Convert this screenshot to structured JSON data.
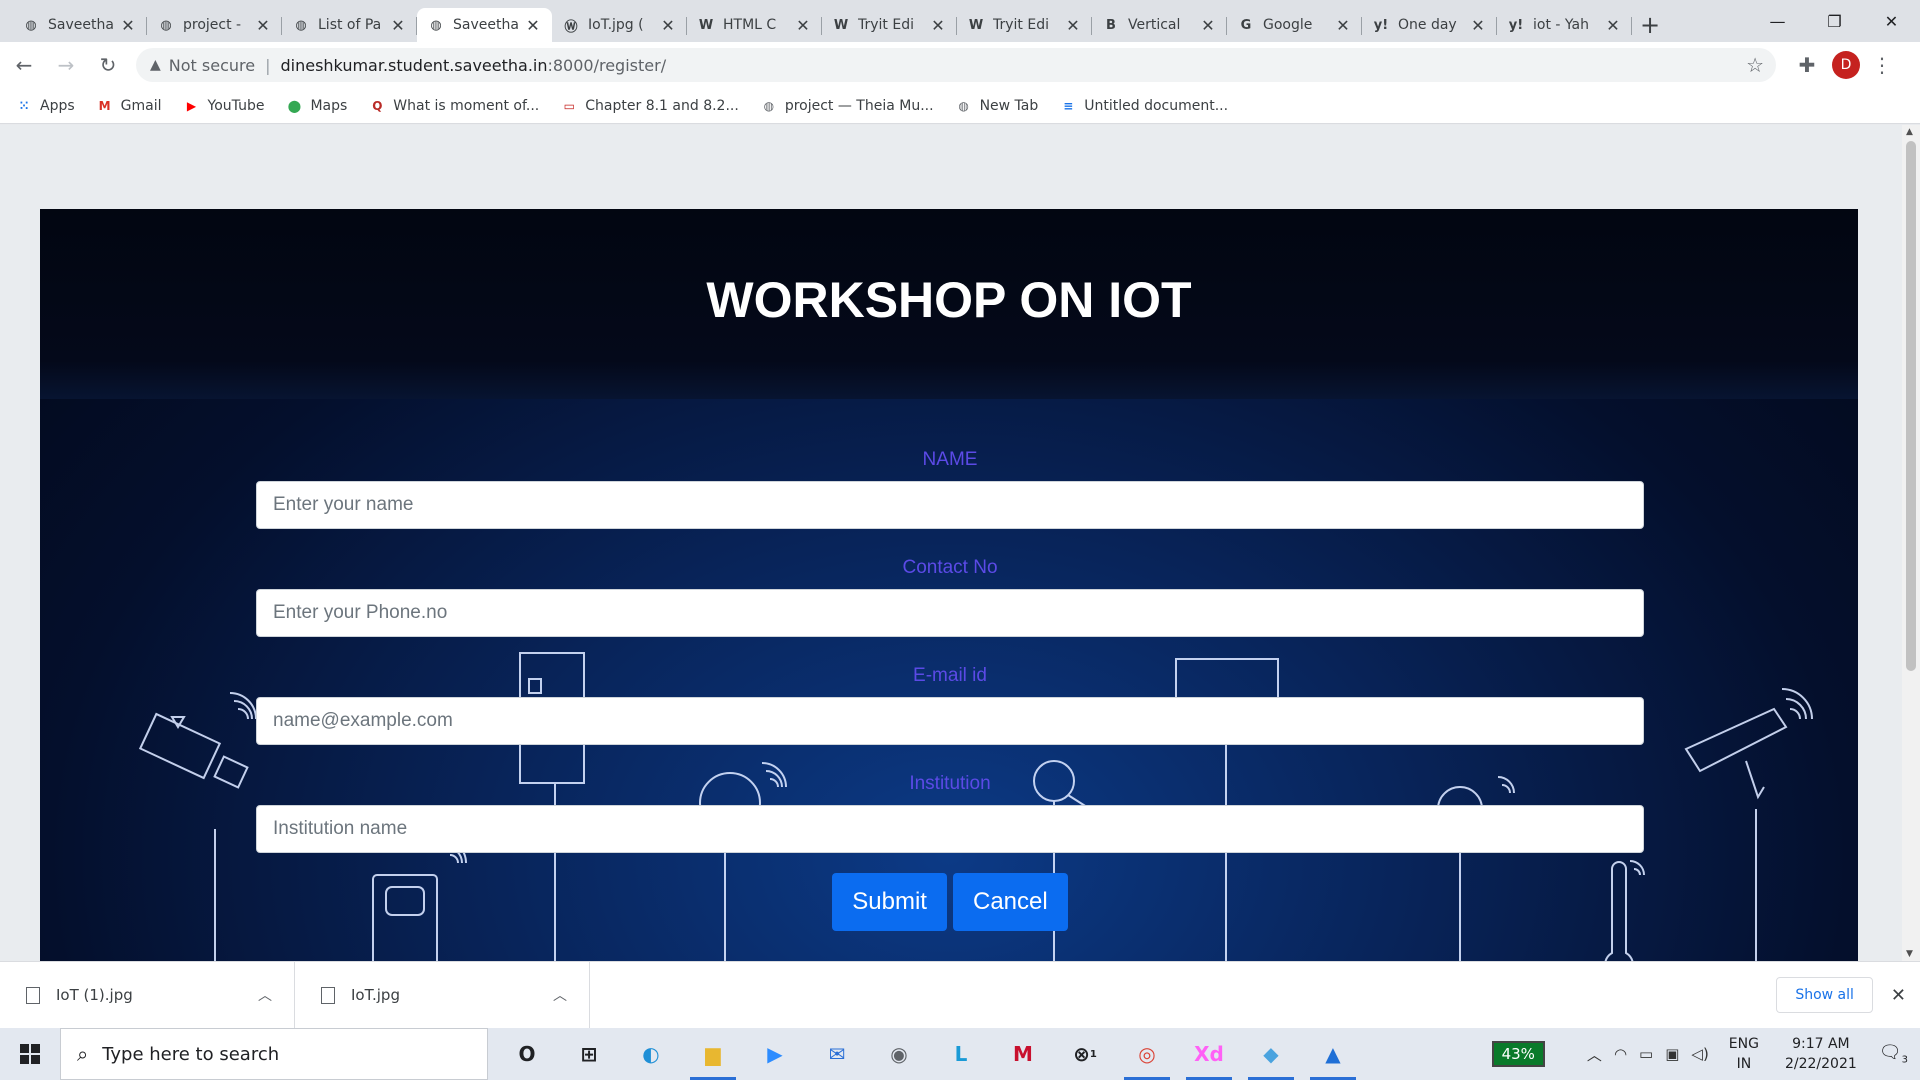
{
  "browser": {
    "tabs": [
      {
        "title": "Saveetha",
        "favicon": "globe-icon",
        "fav_glyph": "◍",
        "active": false
      },
      {
        "title": "project -",
        "favicon": "globe-icon",
        "fav_glyph": "◍",
        "active": false
      },
      {
        "title": "List of Pa",
        "favicon": "globe-icon",
        "fav_glyph": "◍",
        "active": false
      },
      {
        "title": "Saveetha",
        "favicon": "globe-icon",
        "fav_glyph": "◍",
        "active": true
      },
      {
        "title": "IoT.jpg (",
        "favicon": "wordpress-icon",
        "fav_glyph": "Ⓦ",
        "active": false
      },
      {
        "title": "HTML C",
        "favicon": "w3schools-icon",
        "fav_glyph": "W",
        "active": false
      },
      {
        "title": "Tryit Edi",
        "favicon": "w3schools-icon",
        "fav_glyph": "W",
        "active": false
      },
      {
        "title": "Tryit Edi",
        "favicon": "w3schools-icon",
        "fav_glyph": "W",
        "active": false
      },
      {
        "title": "Vertical",
        "favicon": "bootstrap-icon",
        "fav_glyph": "B",
        "active": false
      },
      {
        "title": "Google",
        "favicon": "google-icon",
        "fav_glyph": "G",
        "active": false
      },
      {
        "title": "One day",
        "favicon": "yahoo-icon",
        "fav_glyph": "y!",
        "active": false
      },
      {
        "title": "iot - Yah",
        "favicon": "yahoo-icon",
        "fav_glyph": "y!",
        "active": false
      }
    ],
    "security_label": "Not secure",
    "url_host": "dineshkumar.student.saveetha.in",
    "url_path": ":8000/register/",
    "profile_initial": "D",
    "bookmarks": [
      {
        "label": "Apps",
        "icon": "apps-grid-icon",
        "glyph": "⁙",
        "color": "#1a73e8"
      },
      {
        "label": "Gmail",
        "icon": "gmail-icon",
        "glyph": "M",
        "color": "#d93025"
      },
      {
        "label": "YouTube",
        "icon": "youtube-icon",
        "glyph": "▶",
        "color": "#ff0000"
      },
      {
        "label": "Maps",
        "icon": "maps-pin-icon",
        "glyph": "⬤",
        "color": "#34a853"
      },
      {
        "label": "What is moment of...",
        "icon": "quora-icon",
        "glyph": "Q",
        "color": "#b92b27"
      },
      {
        "label": "Chapter 8.1 and 8.2...",
        "icon": "slides-icon",
        "glyph": "▭",
        "color": "#c5221f"
      },
      {
        "label": "project — Theia Mu...",
        "icon": "globe-icon",
        "glyph": "◍",
        "color": "#5f6368"
      },
      {
        "label": "New Tab",
        "icon": "globe-icon",
        "glyph": "◍",
        "color": "#5f6368"
      },
      {
        "label": "Untitled document...",
        "icon": "docs-icon",
        "glyph": "≡",
        "color": "#1a73e8"
      }
    ]
  },
  "page": {
    "title": "WORKSHOP ON IOT",
    "fields": [
      {
        "label": "NAME",
        "placeholder": "Enter your name"
      },
      {
        "label": "Contact No",
        "placeholder": "Enter your Phone.no"
      },
      {
        "label": "E-mail id",
        "placeholder": "name@example.com"
      },
      {
        "label": "Institution",
        "placeholder": "Institution name"
      }
    ],
    "submit_label": "Submit",
    "cancel_label": "Cancel"
  },
  "downloads": {
    "items": [
      {
        "name": "IoT (1).jpg"
      },
      {
        "name": "IoT.jpg"
      }
    ],
    "show_all_label": "Show all"
  },
  "taskbar": {
    "search_placeholder": "Type here to search",
    "battery": "43%",
    "lang_line1": "ENG",
    "lang_line2": "IN",
    "time": "9:17 AM",
    "date": "2/22/2021",
    "notification_count": "3",
    "xbox_badge": "1",
    "apps": [
      {
        "name": "task-view-icon",
        "glyph": "O",
        "color": "#202124",
        "open": false
      },
      {
        "name": "widgets-icon",
        "glyph": "⊞",
        "color": "#202124",
        "open": false
      },
      {
        "name": "edge-icon",
        "glyph": "◐",
        "color": "#1f8fd6",
        "open": false
      },
      {
        "name": "file-explorer-icon",
        "glyph": "▆",
        "color": "#e8b730",
        "open": true
      },
      {
        "name": "zoom-icon",
        "glyph": "▶",
        "color": "#2d8cff",
        "open": false
      },
      {
        "name": "mail-icon",
        "glyph": "✉",
        "color": "#2b6fd6",
        "open": false
      },
      {
        "name": "camera-icon",
        "glyph": "◉",
        "color": "#5f6368",
        "open": false
      },
      {
        "name": "lens-l-icon",
        "glyph": "L",
        "color": "#1a9ad6",
        "open": false
      },
      {
        "name": "mcafee-icon",
        "glyph": "M",
        "color": "#c8102e",
        "open": false
      },
      {
        "name": "xbox-icon",
        "glyph": "⊗",
        "color": "#202124",
        "open": false
      },
      {
        "name": "chrome-icon",
        "glyph": "◎",
        "color": "#db4437",
        "open": true
      },
      {
        "name": "adobe-xd-icon",
        "glyph": "Xd",
        "color": "#ff61f6",
        "open": true
      },
      {
        "name": "notes-icon",
        "glyph": "◆",
        "color": "#4aa3df",
        "open": true
      },
      {
        "name": "photos-icon",
        "glyph": "▲",
        "color": "#1f6fd6",
        "open": true
      }
    ]
  }
}
